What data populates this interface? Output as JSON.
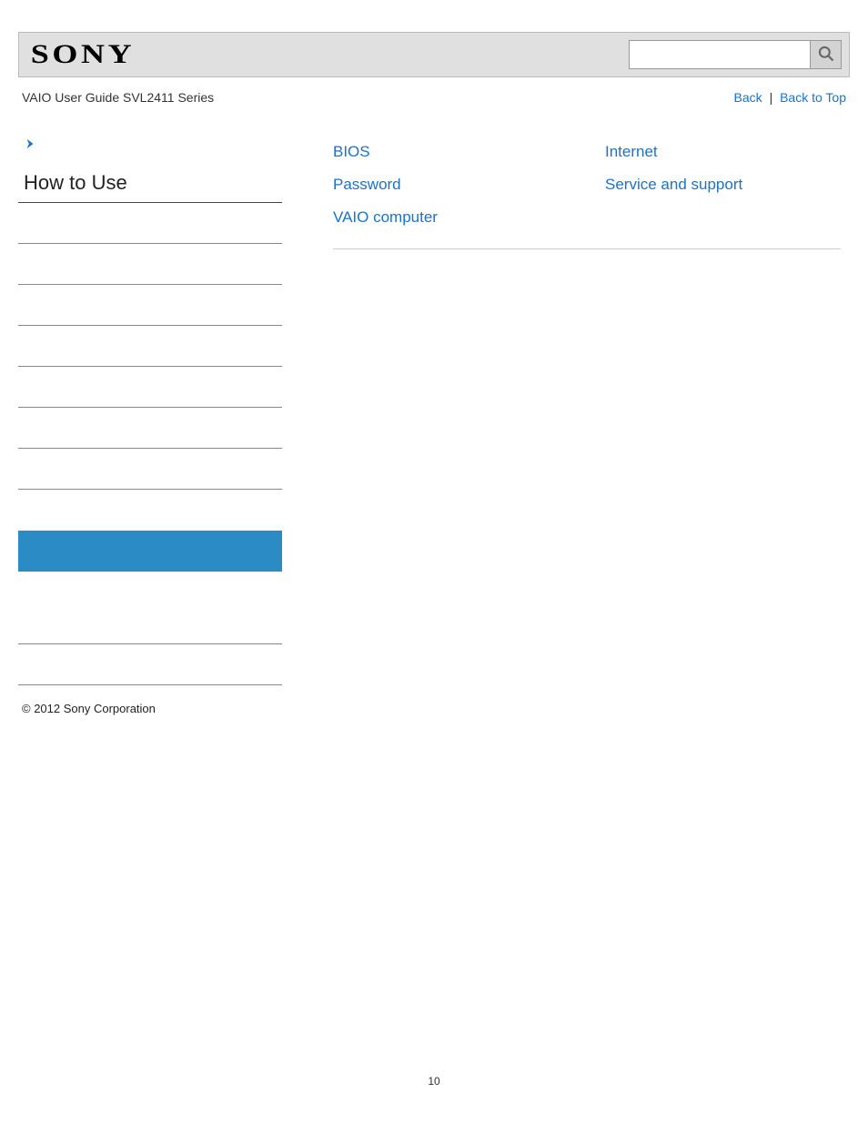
{
  "header": {
    "logo_text": "SONY",
    "search_placeholder": ""
  },
  "subheader": {
    "guide_title": "VAIO User Guide SVL2411 Series",
    "back_label": "Back",
    "back_to_top_label": "Back to Top",
    "separator": "|"
  },
  "sidebar": {
    "section_title": "How to Use"
  },
  "main": {
    "links_col1": {
      "bios": "BIOS",
      "password": "Password",
      "vaio_computer": "VAIO computer"
    },
    "links_col2": {
      "internet": "Internet",
      "service_support": "Service and support"
    }
  },
  "footer": {
    "copyright": "© 2012 Sony Corporation"
  },
  "page_number": "10"
}
